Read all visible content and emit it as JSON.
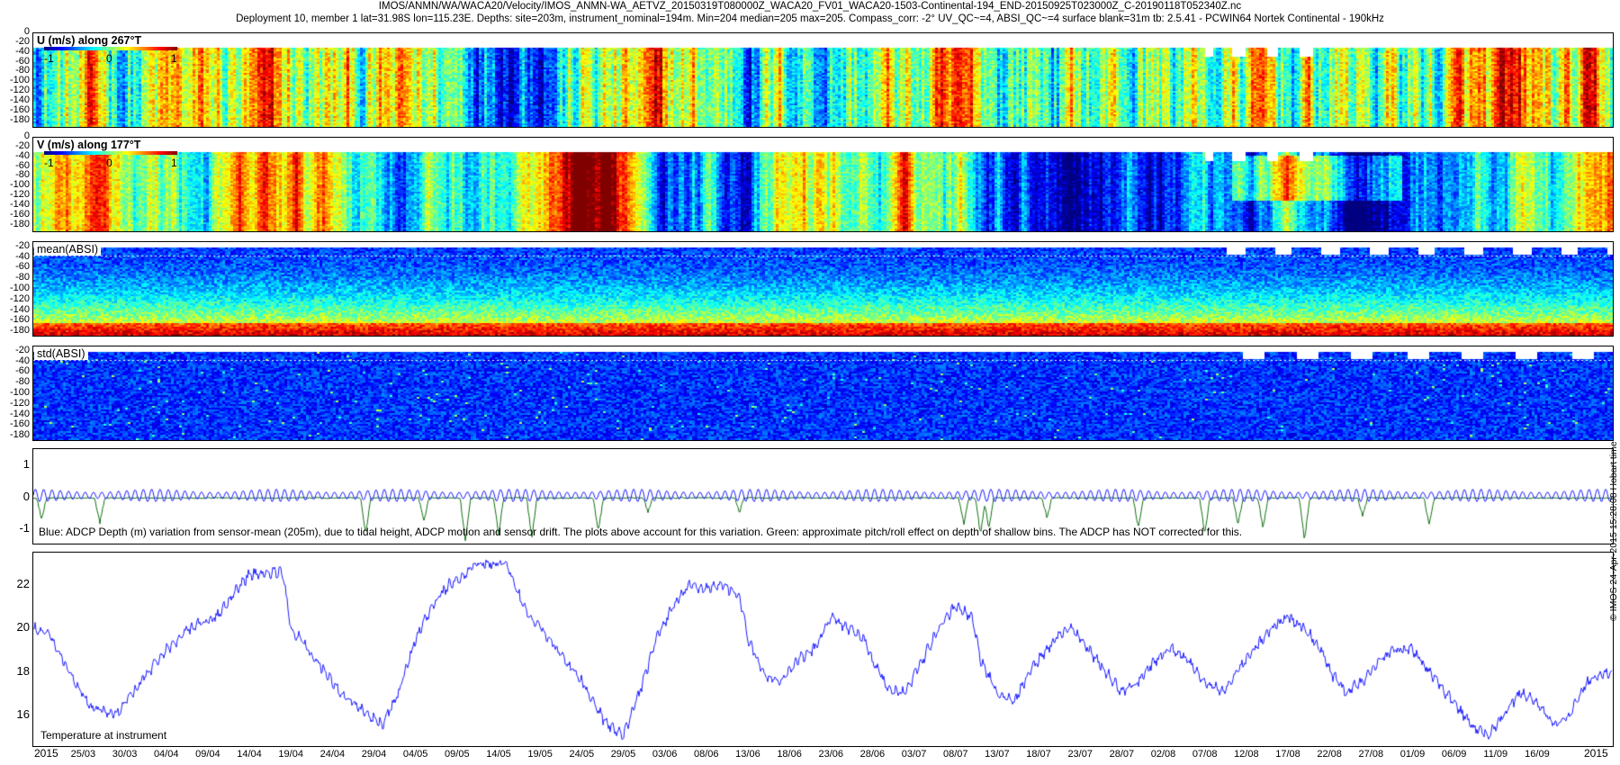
{
  "header": {
    "line1": "IMOS/ANMN/WA/WACA20/Velocity/IMOS_ANMN-WA_AETVZ_20150319T080000Z_WACA20_FV01_WACA20-1503-Continental-194_END-20150925T023000Z_C-20190118T052340Z.nc",
    "line2": "Deployment 10, member 1 lat=31.98S lon=115.23E. Depths: site=203m, instrument_nominal=194m. Min=204 median=205 max=205. Compass_corr: -2° UV_QC~=4, ABSI_QC~=4 surface blank=31m tb: 2.5.41 - PCWIN64 Nortek Continental - 190kHz"
  },
  "side_note": "© IMOS 24-Apr-2015 15:28:08 Hobart time",
  "colors": {
    "line_blue": "#1a1aff",
    "line_green": "#107010"
  },
  "chart_data": [
    {
      "type": "heatmap",
      "title": "U (m/s) along 267°T",
      "colorbar_ticks": [
        "-1",
        "0",
        "1"
      ],
      "clim": [
        -1,
        1
      ],
      "y_ticks": [
        "0",
        "-20",
        "-40",
        "-60",
        "-80",
        "-100",
        "-120",
        "-140",
        "-160",
        "-180"
      ],
      "ylim": [
        -195,
        0
      ],
      "blank_depth": -22
    },
    {
      "type": "heatmap",
      "title": "V (m/s) along 177°T",
      "colorbar_ticks": [
        "-1",
        "0",
        "1"
      ],
      "clim": [
        -1,
        1
      ],
      "y_ticks": [
        "0",
        "-20",
        "-40",
        "-60",
        "-80",
        "-100",
        "-120",
        "-140",
        "-160",
        "-180"
      ],
      "ylim": [
        -195,
        0
      ],
      "blank_depth": -22
    },
    {
      "type": "heatmap",
      "title": "mean(ABSI)",
      "y_ticks": [
        "-20",
        "-40",
        "-60",
        "-80",
        "-100",
        "-120",
        "-140",
        "-160",
        "-180"
      ],
      "ylim": [
        -190,
        -10
      ]
    },
    {
      "type": "heatmap",
      "title": "std(ABSI)",
      "y_ticks": [
        "-20",
        "-40",
        "-60",
        "-80",
        "-100",
        "-120",
        "-140",
        "-160",
        "-180"
      ],
      "ylim": [
        -190,
        -10
      ]
    },
    {
      "type": "line",
      "caption": "Blue: ADCP Depth (m) variation from sensor-mean (205m), due to tidal height, ADCP motion and sensor drift. The plots above account for this variation. Green: approximate pitch/roll effect on depth of shallow bins. The ADCP has NOT corrected for this.",
      "y_ticks": [
        "1",
        "0",
        "-1"
      ],
      "ylim": [
        -1.5,
        1.5
      ],
      "series": [
        {
          "color": "blue",
          "amplitude": 0.2,
          "tidal_period_days": 1
        },
        {
          "color": "green",
          "dips": [
            {
              "date": "2015-03-20",
              "depth": -0.7
            },
            {
              "date": "2015-03-27",
              "depth": -0.85
            },
            {
              "date": "2015-04-28",
              "depth": -1.2
            },
            {
              "date": "2015-05-05",
              "depth": -0.8
            },
            {
              "date": "2015-05-10",
              "depth": -1.4
            },
            {
              "date": "2015-05-14",
              "depth": -1.2
            },
            {
              "date": "2015-05-18",
              "depth": -1.3
            },
            {
              "date": "2015-05-26",
              "depth": -1.1
            },
            {
              "date": "2015-06-01",
              "depth": -0.5
            },
            {
              "date": "2015-06-12",
              "depth": -0.5
            },
            {
              "date": "2015-07-09",
              "depth": -0.9
            },
            {
              "date": "2015-07-11",
              "depth": -1.2
            },
            {
              "date": "2015-07-12",
              "depth": -1.0
            },
            {
              "date": "2015-07-19",
              "depth": -0.7
            },
            {
              "date": "2015-07-30",
              "depth": -1.0
            },
            {
              "date": "2015-08-07",
              "depth": -1.2
            },
            {
              "date": "2015-08-11",
              "depth": -0.9
            },
            {
              "date": "2015-08-14",
              "depth": -1.0
            },
            {
              "date": "2015-08-19",
              "depth": -1.4
            },
            {
              "date": "2015-08-26",
              "depth": -0.6
            },
            {
              "date": "2015-09-03",
              "depth": -0.9
            }
          ]
        }
      ]
    },
    {
      "type": "line",
      "caption": "Temperature at instrument",
      "y_ticks": [
        "22",
        "20",
        "18",
        "16"
      ],
      "ylim": [
        14.5,
        23.5
      ],
      "series": [
        {
          "color": "blue",
          "points": [
            [
              "2015-03-19",
              20.0
            ],
            [
              "2015-03-21",
              19.6
            ],
            [
              "2015-03-24",
              17.5
            ],
            [
              "2015-03-26",
              16.3
            ],
            [
              "2015-03-29",
              16.0
            ],
            [
              "2015-04-01",
              17.5
            ],
            [
              "2015-04-04",
              19.0
            ],
            [
              "2015-04-07",
              20.0
            ],
            [
              "2015-04-10",
              20.5
            ],
            [
              "2015-04-12",
              21.5
            ],
            [
              "2015-04-14",
              22.5
            ],
            [
              "2015-04-18",
              22.6
            ],
            [
              "2015-04-19",
              20.0
            ],
            [
              "2015-04-22",
              18.5
            ],
            [
              "2015-04-25",
              17.0
            ],
            [
              "2015-04-28",
              16.0
            ],
            [
              "2015-04-30",
              15.5
            ],
            [
              "2015-05-02",
              17.0
            ],
            [
              "2015-05-04",
              19.5
            ],
            [
              "2015-05-06",
              21.0
            ],
            [
              "2015-05-08",
              22.0
            ],
            [
              "2015-05-10",
              22.5
            ],
            [
              "2015-05-11",
              23.0
            ],
            [
              "2015-05-15",
              23.0
            ],
            [
              "2015-05-17",
              21.0
            ],
            [
              "2015-05-20",
              19.5
            ],
            [
              "2015-05-24",
              17.5
            ],
            [
              "2015-05-27",
              15.5
            ],
            [
              "2015-05-29",
              15.0
            ],
            [
              "2015-05-31",
              17.0
            ],
            [
              "2015-06-02",
              19.5
            ],
            [
              "2015-06-04",
              21.0
            ],
            [
              "2015-06-06",
              22.0
            ],
            [
              "2015-06-08",
              21.8
            ],
            [
              "2015-06-10",
              22.0
            ],
            [
              "2015-06-12",
              21.5
            ],
            [
              "2015-06-13",
              19.5
            ],
            [
              "2015-06-15",
              17.8
            ],
            [
              "2015-06-17",
              17.5
            ],
            [
              "2015-06-19",
              18.5
            ],
            [
              "2015-06-21",
              19.0
            ],
            [
              "2015-06-23",
              20.5
            ],
            [
              "2015-06-25",
              20.0
            ],
            [
              "2015-06-27",
              19.5
            ],
            [
              "2015-06-28",
              18.5
            ],
            [
              "2015-06-30",
              17.0
            ],
            [
              "2015-07-02",
              17.0
            ],
            [
              "2015-07-04",
              18.5
            ],
            [
              "2015-07-06",
              20.0
            ],
            [
              "2015-07-08",
              21.0
            ],
            [
              "2015-07-10",
              20.5
            ],
            [
              "2015-07-11",
              18.5
            ],
            [
              "2015-07-13",
              17.0
            ],
            [
              "2015-07-15",
              16.5
            ],
            [
              "2015-07-17",
              18.0
            ],
            [
              "2015-07-20",
              19.5
            ],
            [
              "2015-07-22",
              20.0
            ],
            [
              "2015-07-24",
              19.0
            ],
            [
              "2015-07-26",
              18.0
            ],
            [
              "2015-07-28",
              17.0
            ],
            [
              "2015-07-30",
              17.5
            ],
            [
              "2015-08-01",
              18.5
            ],
            [
              "2015-08-03",
              19.0
            ],
            [
              "2015-08-05",
              18.5
            ],
            [
              "2015-08-07",
              17.5
            ],
            [
              "2015-08-09",
              17.0
            ],
            [
              "2015-08-11",
              18.0
            ],
            [
              "2015-08-13",
              19.0
            ],
            [
              "2015-08-15",
              20.0
            ],
            [
              "2015-08-17",
              20.5
            ],
            [
              "2015-08-19",
              20.0
            ],
            [
              "2015-08-21",
              19.0
            ],
            [
              "2015-08-22",
              18.0
            ],
            [
              "2015-08-24",
              17.0
            ],
            [
              "2015-08-26",
              17.5
            ],
            [
              "2015-08-28",
              18.5
            ],
            [
              "2015-08-30",
              19.0
            ],
            [
              "2015-09-01",
              19.0
            ],
            [
              "2015-09-03",
              18.0
            ],
            [
              "2015-09-05",
              17.0
            ],
            [
              "2015-09-06",
              16.5
            ],
            [
              "2015-09-08",
              15.5
            ],
            [
              "2015-09-10",
              15.0
            ],
            [
              "2015-09-12",
              16.0
            ],
            [
              "2015-09-14",
              17.0
            ],
            [
              "2015-09-16",
              16.5
            ],
            [
              "2015-09-18",
              15.5
            ],
            [
              "2015-09-20",
              16.0
            ],
            [
              "2015-09-22",
              17.5
            ],
            [
              "2015-09-25",
              18.0
            ]
          ]
        }
      ]
    }
  ],
  "x_axis": {
    "year_left": "2015",
    "year_right": "2015",
    "ticks": [
      "25/03",
      "30/03",
      "04/04",
      "09/04",
      "14/04",
      "19/04",
      "24/04",
      "29/04",
      "04/05",
      "09/05",
      "14/05",
      "19/05",
      "24/05",
      "29/05",
      "03/06",
      "08/06",
      "13/06",
      "18/06",
      "23/06",
      "28/06",
      "03/07",
      "08/07",
      "13/07",
      "18/07",
      "23/07",
      "28/07",
      "02/08",
      "07/08",
      "12/08",
      "17/08",
      "22/08",
      "27/08",
      "01/09",
      "06/09",
      "11/09",
      "16/09"
    ]
  }
}
